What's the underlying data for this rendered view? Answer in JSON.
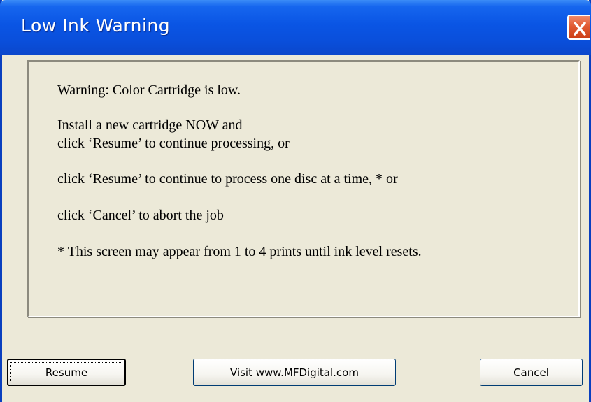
{
  "window": {
    "title": "Low Ink Warning",
    "close_icon": "close-icon"
  },
  "message": {
    "line1": "Warning: Color Cartridge is low.",
    "line2": "Install a new cartridge NOW and",
    "line3": "click ‘Resume’ to continue processing, or",
    "line4": "click ‘Resume’ to continue to process one disc at a time, * or",
    "line5": "click ‘Cancel’ to abort the job",
    "line6": "* This screen may appear from 1 to 4 prints until ink level resets."
  },
  "buttons": {
    "resume": "Resume",
    "visit": "Visit www.MFDigital.com",
    "cancel": "Cancel"
  }
}
